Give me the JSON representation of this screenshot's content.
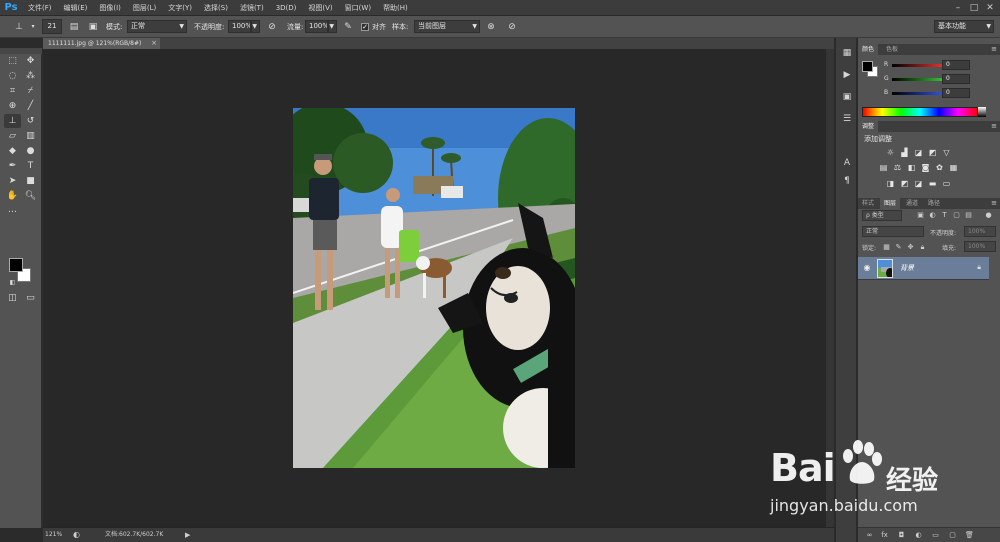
{
  "app": {
    "logo": "Ps"
  },
  "menu": [
    "文件(F)",
    "编辑(E)",
    "图像(I)",
    "图层(L)",
    "文字(Y)",
    "选择(S)",
    "滤镜(T)",
    "3D(D)",
    "视图(V)",
    "窗口(W)",
    "帮助(H)"
  ],
  "window_controls": {
    "minimize": "–",
    "maximize": "□",
    "close": "✕"
  },
  "options": {
    "brush_size": "21",
    "mode_label": "模式:",
    "mode_value": "正常",
    "opacity_label": "不透明度:",
    "opacity_value": "100%",
    "flow_label": "流量:",
    "flow_value": "100%",
    "aligned_label": "对齐",
    "aligned_checked": "✓",
    "sample_label": "样本:",
    "sample_value": "当前图层",
    "workspace": "基本功能"
  },
  "document": {
    "tab_title": "1111111.jpg @ 121%(RGB/8#)",
    "tab_close": "×"
  },
  "status": {
    "zoom": "121%",
    "doc_info": "文档:602.7K/602.7K"
  },
  "color_panel": {
    "tabs": [
      "颜色",
      "色板"
    ],
    "channels": [
      {
        "label": "R",
        "value": "0",
        "color": "#e03030"
      },
      {
        "label": "G",
        "value": "0",
        "color": "#30c030"
      },
      {
        "label": "B",
        "value": "0",
        "color": "#3050e0"
      }
    ]
  },
  "adjust_panel": {
    "tab": "调整",
    "add_label": "添加调整"
  },
  "layers_panel": {
    "tabs": [
      "样式",
      "图层",
      "通道",
      "路径"
    ],
    "filter_type": "ρ 类型",
    "blend_mode": "正常",
    "opacity_label": "不透明度:",
    "opacity_value": "100%",
    "lock_label": "锁定:",
    "fill_label": "填充:",
    "fill_value": "100%",
    "layer_name": "背景"
  },
  "watermark": {
    "brand_latin": "Bai",
    "brand_cn": "经验",
    "url": "jingyan.baidu.com"
  },
  "colors": {
    "accent": "#31a8ff",
    "layer_selected": "#6b7e99",
    "foreground": "#000000",
    "background": "#ffffff"
  }
}
